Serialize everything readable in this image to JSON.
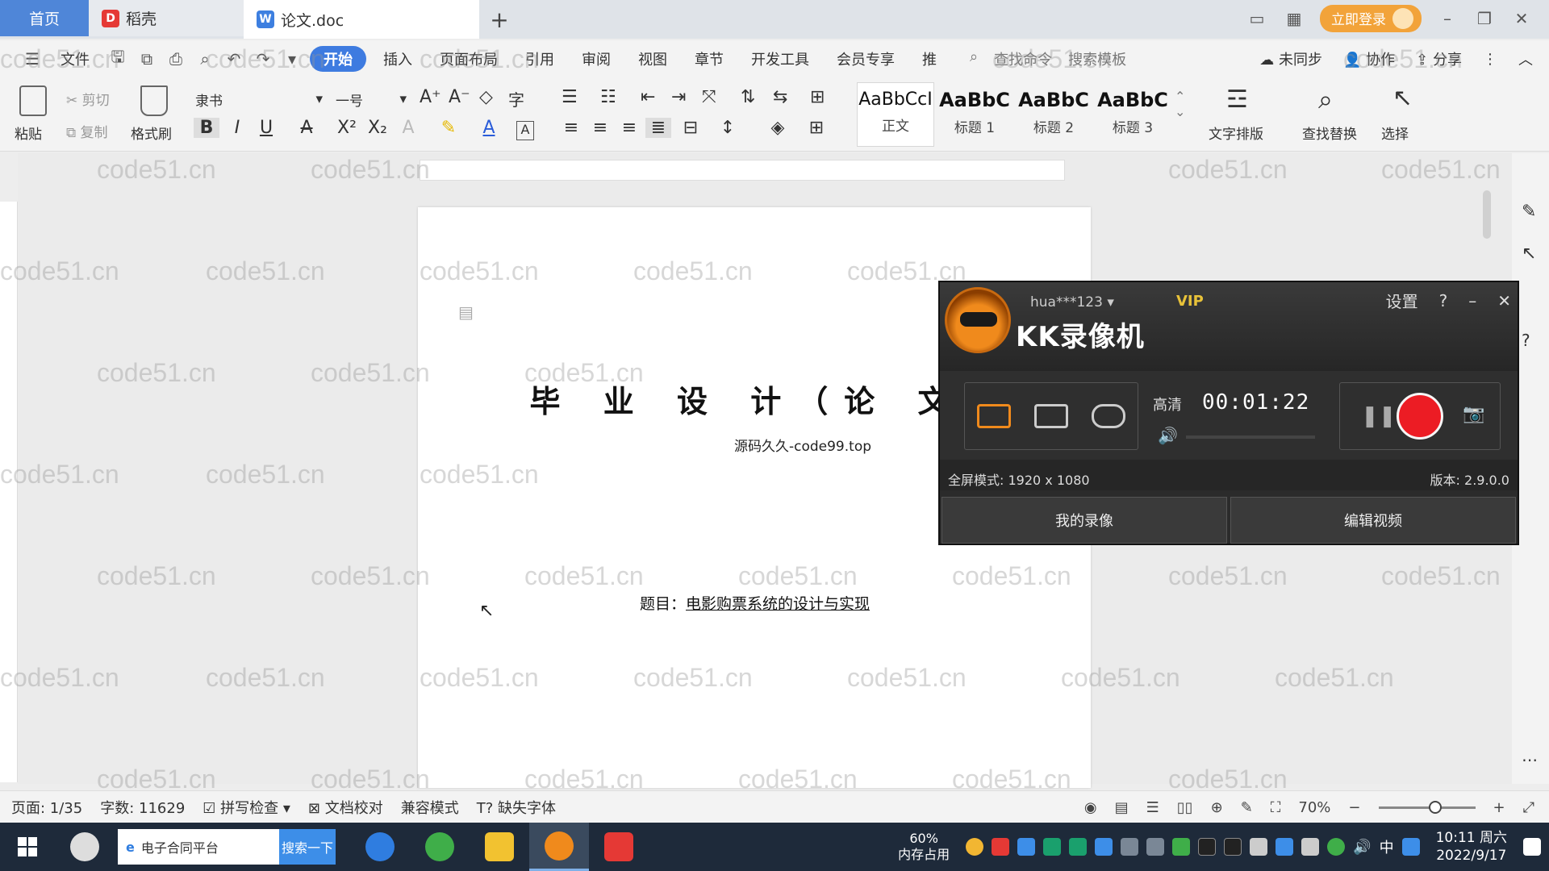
{
  "tabs": {
    "home": "首页",
    "daoke": "稻壳",
    "doc": "论文.doc"
  },
  "title_right": {
    "login": "立即登录"
  },
  "menu": {
    "file": "文件",
    "items": [
      "开始",
      "插入",
      "页面布局",
      "引用",
      "审阅",
      "视图",
      "章节",
      "开发工具",
      "会员专享",
      "推"
    ],
    "search_command": "查找命令",
    "search_template": "搜索模板",
    "unsynced": "未同步",
    "collaborate": "协作",
    "share": "分享"
  },
  "ribbon": {
    "paste": "粘贴",
    "cut": "剪切",
    "copy": "复制",
    "format_painter": "格式刷",
    "font_name": "隶书",
    "font_size": "一号",
    "styles": [
      {
        "sample": "AaBbCcI",
        "label": "正文"
      },
      {
        "sample": "AaBbC",
        "label": "标题 1"
      },
      {
        "sample": "AaBbC",
        "label": "标题 2"
      },
      {
        "sample": "AaBbC",
        "label": "标题 3"
      }
    ],
    "text_layout": "文字排版",
    "find_replace": "查找替换",
    "select": "选择"
  },
  "document": {
    "title": "毕 业 设 计（论 文）",
    "source": "源码久久-code99.top",
    "topic_label": "题目：",
    "topic_value": "电影购票系统的设计与实现"
  },
  "watermark": "code51.cn",
  "recorder": {
    "user": "hua***123",
    "vip": "VIP",
    "brand": "KK录像机",
    "settings": "设置",
    "quality": "高清",
    "time": "00:01:22",
    "mode_info": "全屏模式: 1920 x 1080",
    "version": "版本: 2.9.0.0",
    "my_videos": "我的录像",
    "edit_video": "编辑视频"
  },
  "status": {
    "page": "页面: 1/35",
    "words": "字数: 11629",
    "spell": "拼写检查",
    "proof": "文档校对",
    "compat": "兼容模式",
    "missing_font": "缺失字体",
    "zoom": "70%"
  },
  "taskbar": {
    "search_text": "电子合同平台",
    "search_btn": "搜索一下",
    "memory_pct": "60%",
    "memory_label": "内存占用",
    "ime": "中",
    "time": "10:11 周六",
    "date": "2022/9/17"
  },
  "colors": {
    "accent": "#3e7be0",
    "record": "#ec1c24",
    "kk_orange": "#f08a1c",
    "login": "#f2a33a"
  }
}
